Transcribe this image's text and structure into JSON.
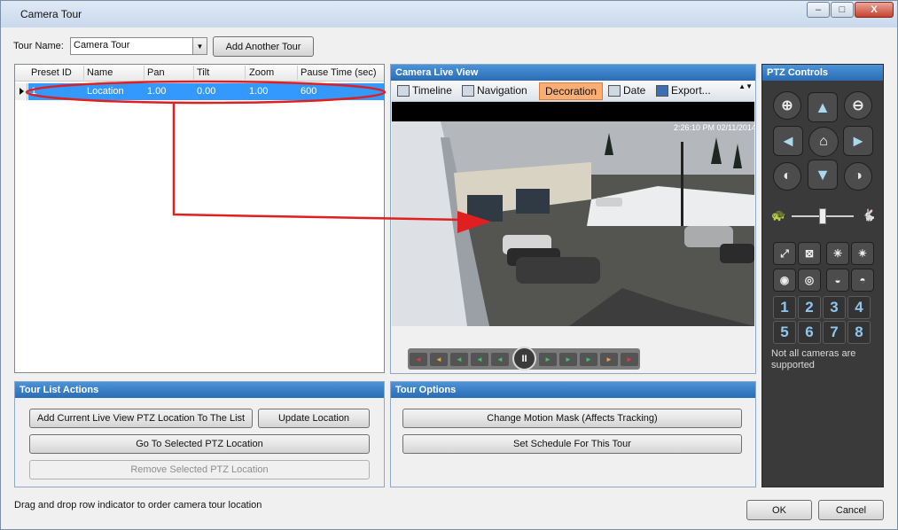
{
  "window": {
    "title": "Camera Tour",
    "controls": {
      "minimize": "–",
      "maximize": "□",
      "close": "X"
    }
  },
  "tour": {
    "name_label": "Tour Name:",
    "name_value": "Camera Tour",
    "add_button": "Add Another Tour"
  },
  "grid": {
    "columns": [
      "Preset ID",
      "Name",
      "Pan",
      "Tilt",
      "Zoom",
      "Pause Time (sec)"
    ],
    "rows": [
      {
        "preset_id": "1",
        "name": "Location",
        "pan": "1.00",
        "tilt": "0.00",
        "zoom": "1.00",
        "pause": "600"
      }
    ]
  },
  "live_view": {
    "title": "Camera Live View",
    "toolbar": {
      "timeline": "Timeline",
      "navigation": "Navigation",
      "decoration": "Decoration",
      "date": "Date",
      "export": "Export..."
    },
    "timestamp": "2:26:10 PM 02/11/2014"
  },
  "ptz": {
    "title": "PTZ Controls",
    "presets": [
      "1",
      "2",
      "3",
      "4",
      "5",
      "6",
      "7",
      "8"
    ],
    "note": "Not all cameras are supported"
  },
  "tour_list_actions": {
    "title": "Tour List Actions",
    "add_current": "Add Current Live View PTZ Location To The List",
    "update": "Update Location",
    "go_to": "Go To Selected PTZ Location",
    "remove": "Remove Selected PTZ Location"
  },
  "tour_options": {
    "title": "Tour Options",
    "motion_mask": "Change Motion Mask (Affects Tracking)",
    "schedule": "Set Schedule For This Tour"
  },
  "footer": {
    "hint": "Drag and drop row indicator to order camera tour location",
    "ok": "OK",
    "cancel": "Cancel"
  },
  "colors": {
    "accent_header": "#2a6cb6",
    "selection": "#3399ff",
    "annotation": "#e02020",
    "decoration_active": "#fbae73"
  },
  "icons": [
    "zoom-in-icon",
    "zoom-out-icon",
    "arrow-up-icon",
    "arrow-down-icon",
    "arrow-left-icon",
    "arrow-right-icon",
    "home-icon",
    "turtle-icon",
    "rabbit-icon"
  ]
}
